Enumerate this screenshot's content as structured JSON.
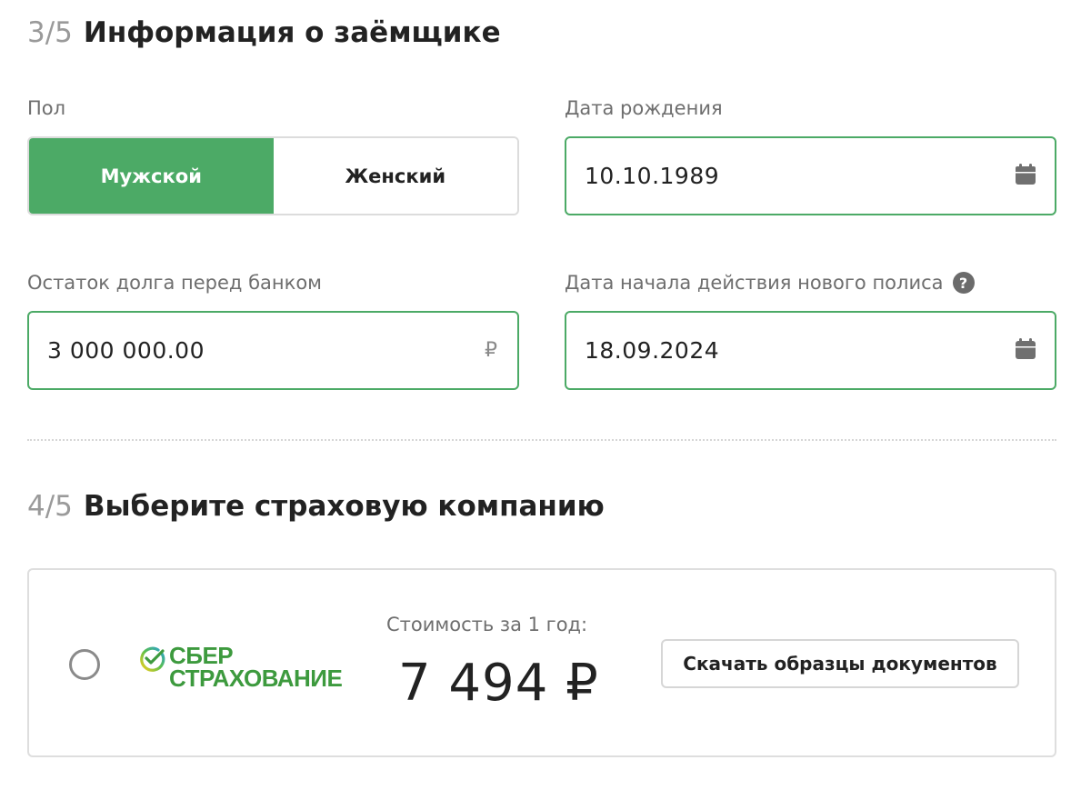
{
  "step3": {
    "number": "3/5",
    "title": "Информация о заёмщике",
    "gender": {
      "label": "Пол",
      "options": [
        "Мужской",
        "Женский"
      ],
      "selected": "Мужской"
    },
    "birth_date": {
      "label": "Дата рождения",
      "value": "10.10.1989",
      "icon": "calendar-icon"
    },
    "debt": {
      "label": "Остаток долга перед банком",
      "value": "3 000 000.00",
      "currency": "₽"
    },
    "policy_start": {
      "label": "Дата начала действия нового полиса",
      "value": "18.09.2024",
      "icon": "calendar-icon",
      "help_icon": "?"
    }
  },
  "step4": {
    "number": "4/5",
    "title": "Выберите страховую компанию",
    "insurer": {
      "logo_line1": "СБЕР",
      "logo_line2": "СТРАХОВАНИЕ",
      "price_label": "Стоимость за 1 год:",
      "price": "7 494 ₽",
      "download_label": "Скачать образцы документов",
      "selected": false
    }
  },
  "colors": {
    "accent": "#4caa66",
    "sber_green": "#3d9a3e",
    "muted_text": "#6e6e6e",
    "border": "#dcdcdc"
  }
}
